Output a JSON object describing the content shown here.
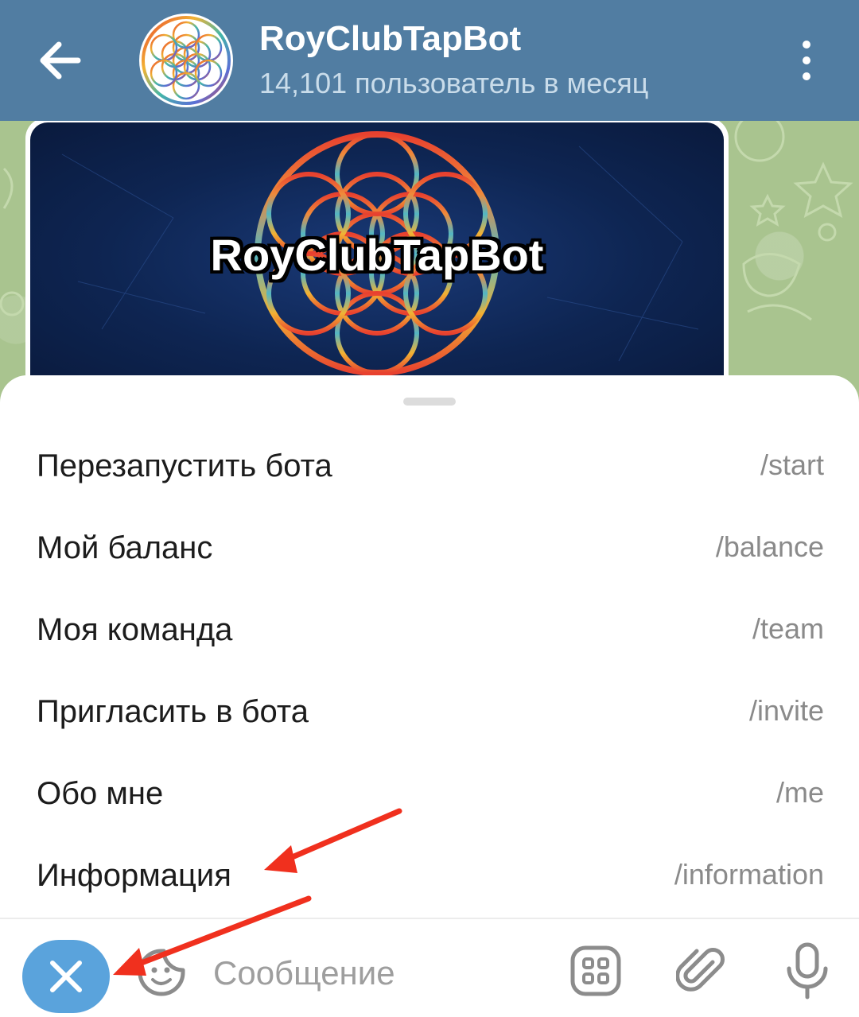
{
  "header": {
    "title": "RoyClubTapBot",
    "subtitle": "14,101 пользователь в месяц",
    "color": "#517da2"
  },
  "message": {
    "banner_title": "RoyClubTapBot"
  },
  "commands": [
    {
      "label": "Перезапустить бота",
      "command": "/start"
    },
    {
      "label": "Мой баланс",
      "command": "/balance"
    },
    {
      "label": "Моя команда",
      "command": "/team"
    },
    {
      "label": "Пригласить в бота",
      "command": "/invite"
    },
    {
      "label": "Обо мне",
      "command": "/me"
    },
    {
      "label": "Информация",
      "command": "/information"
    }
  ],
  "input": {
    "placeholder": "Сообщение"
  },
  "icons": {
    "back": "arrow-left-icon",
    "more": "more-vertical-icon",
    "close": "close-icon",
    "sticker": "sticker-icon",
    "commands": "bot-commands-icon",
    "attach": "paperclip-icon",
    "mic": "microphone-icon"
  },
  "colors": {
    "accent": "#5aa3dc",
    "annotation_arrow": "#f0301e",
    "chat_background": "#a9c48f"
  }
}
